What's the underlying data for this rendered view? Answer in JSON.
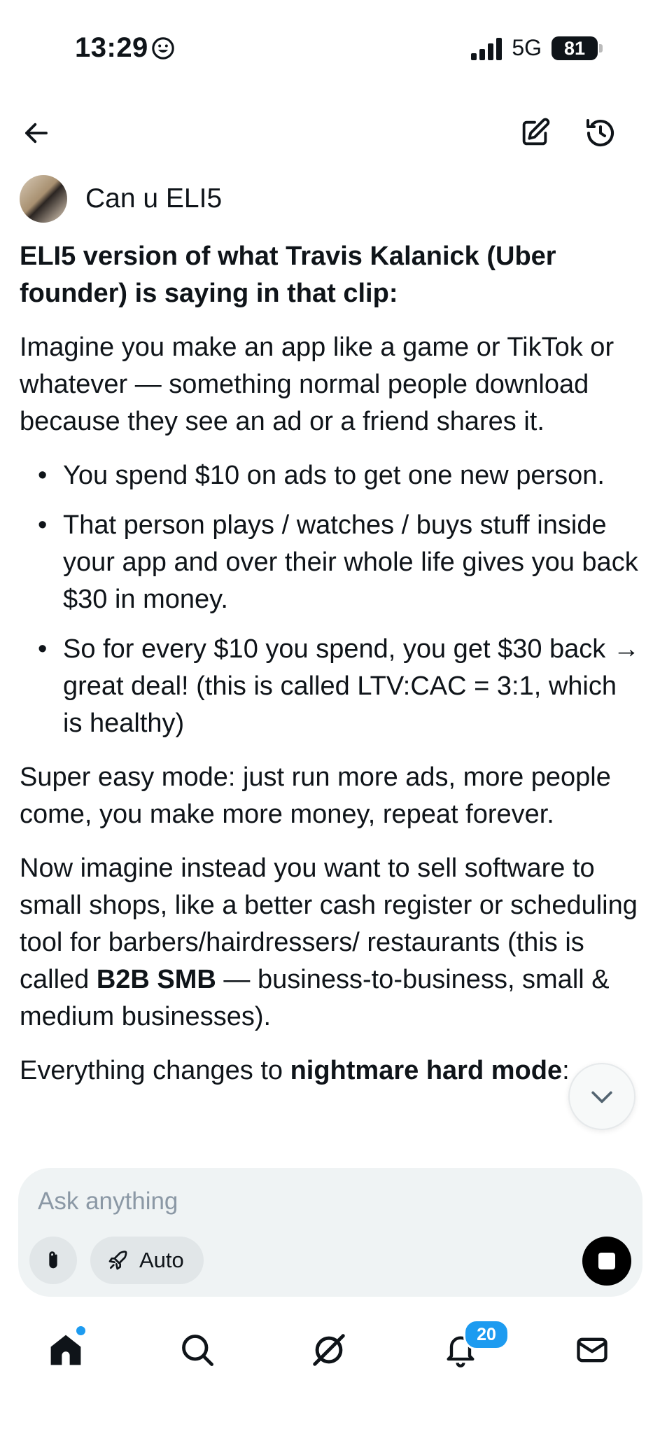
{
  "status_bar": {
    "time": "13:29",
    "network": "5G",
    "battery": "81"
  },
  "topbar": {
    "back_icon": "arrow-left-icon",
    "edit_icon": "edit-icon",
    "history_icon": "history-icon"
  },
  "chat": {
    "title": "Can u ELI5"
  },
  "message": {
    "heading": "ELI5 version of what Travis Kalanick (Uber founder) is saying in that clip:",
    "intro": "Imagine you make an app like a game or TikTok or whatever — something normal people download because they see an ad or a friend shares it.",
    "bullets": [
      "You spend $10 on ads to get one new person.",
      "That person plays / watches / buys stuff inside your app and over their whole life gives you back $30 in money.",
      "So for every $10 you spend, you get $30 back → great deal! (this is called LTV:CAC = 3:1, which is healthy)"
    ],
    "easy_mode": "Super easy mode: just run more ads, more people come, you make more money, repeat forever.",
    "b2b_part1": "Now imagine instead you want to sell software to small shops, like a better cash register or scheduling tool for barbers/hairdressers/ restaurants (this is called ",
    "b2b_bold": "B2B SMB",
    "b2b_part2": " — business-to-business, small & medium businesses).",
    "hard_part1": "Everything changes to ",
    "hard_bold": "nightmare hard mode",
    "hard_part2": ":"
  },
  "composer": {
    "placeholder": "Ask anything",
    "mode_label": "Auto"
  },
  "bottom_nav": {
    "notifications_count": "20"
  },
  "colors": {
    "accent": "#1d9bf0",
    "text": "#0f1419",
    "composer_bg": "#eff3f4"
  }
}
